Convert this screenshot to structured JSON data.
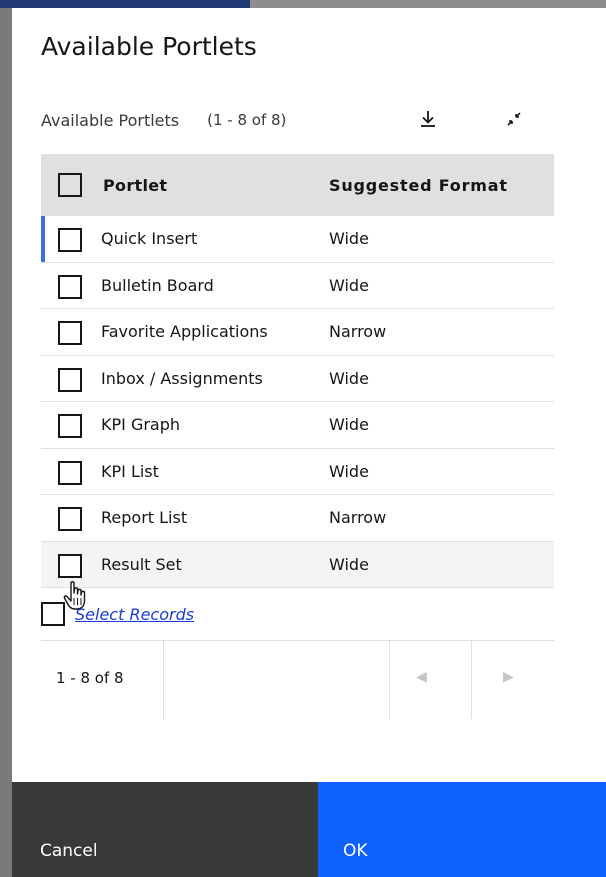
{
  "modal": {
    "title": "Available Portlets"
  },
  "toolbar": {
    "title": "Available Portlets",
    "count": "(1 - 8 of 8)",
    "download_icon": "download-icon",
    "collapse_icon": "collapse-icon"
  },
  "table": {
    "columns": [
      "Portlet",
      "Suggested Format"
    ],
    "rows": [
      {
        "name": "Quick Insert",
        "format": "Wide"
      },
      {
        "name": "Bulletin Board",
        "format": "Wide"
      },
      {
        "name": "Favorite Applications",
        "format": "Narrow"
      },
      {
        "name": "Inbox / Assignments",
        "format": "Wide"
      },
      {
        "name": "KPI Graph",
        "format": "Wide"
      },
      {
        "name": "KPI List",
        "format": "Wide"
      },
      {
        "name": "Report List",
        "format": "Narrow"
      },
      {
        "name": "Result Set",
        "format": "Wide"
      }
    ]
  },
  "select_records": {
    "label": "Select Records"
  },
  "pagination": {
    "count": "1 - 8 of 8"
  },
  "footer": {
    "cancel_label": "Cancel",
    "ok_label": "OK"
  },
  "colors": {
    "primary": "#0f62fe",
    "secondary": "#393939",
    "link": "#1a3bd6",
    "accent": "#3a6fe0"
  }
}
